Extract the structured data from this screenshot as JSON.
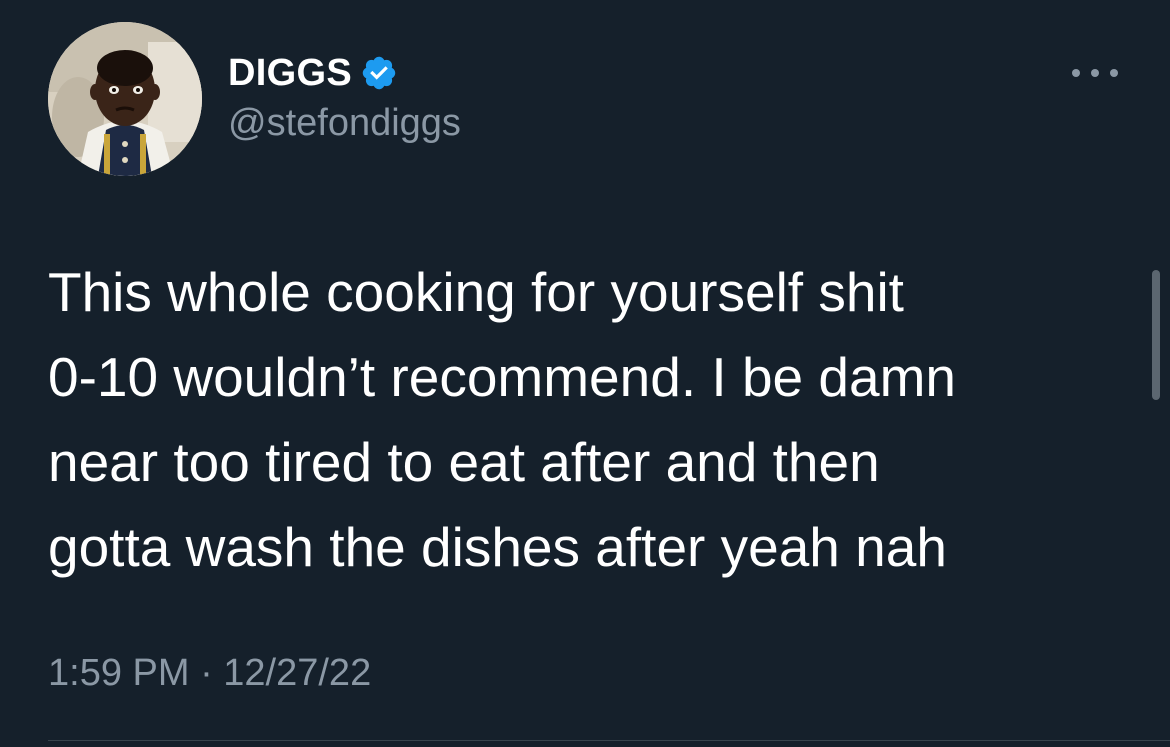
{
  "tweet": {
    "author": {
      "display_name": "DIGGS",
      "handle": "@stefondiggs",
      "verified": true,
      "verified_badge_icon": "verified-badge-icon",
      "avatar": "avatar-photo"
    },
    "more_icon": "more-options-icon",
    "text_lines": [
      "This whole cooking for yourself shit",
      "0-10 wouldn’t recommend. I be damn",
      "near too tired to eat after and then",
      "gotta wash the dishes after yeah nah"
    ],
    "timestamp": "1:59 PM · 12/27/22"
  },
  "colors": {
    "background": "#15202b",
    "text_primary": "#ffffff",
    "text_secondary": "#8b98a5",
    "verified_blue": "#1d9bf0",
    "divider": "#38444d"
  }
}
